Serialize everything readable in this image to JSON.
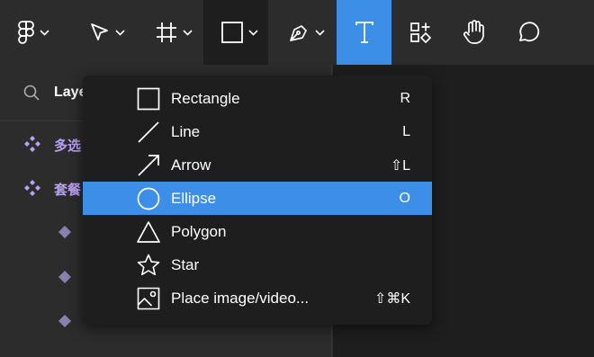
{
  "toolbar": {
    "tools": [
      {
        "name": "main-menu",
        "icon": "figma-logo-icon",
        "has_dropdown": true
      },
      {
        "name": "move",
        "icon": "move-cursor-icon",
        "has_dropdown": true
      },
      {
        "name": "frame",
        "icon": "frame-hash-icon",
        "has_dropdown": true
      },
      {
        "name": "shape",
        "icon": "rectangle-icon",
        "has_dropdown": true,
        "state": "open"
      },
      {
        "name": "pen",
        "icon": "pen-icon",
        "has_dropdown": true
      },
      {
        "name": "text",
        "icon": "text-icon",
        "has_dropdown": false,
        "state": "selected"
      },
      {
        "name": "resources",
        "icon": "resources-icon",
        "has_dropdown": false
      },
      {
        "name": "hand",
        "icon": "hand-icon",
        "has_dropdown": false
      },
      {
        "name": "comment",
        "icon": "comment-icon",
        "has_dropdown": false
      }
    ],
    "accent_color": "#3d8ee6"
  },
  "left_panel": {
    "search_label": "Laye",
    "layers": [
      {
        "name": "多选",
        "icon": "component-icon",
        "color": "#b9a1f5"
      },
      {
        "name": "套餐",
        "icon": "component-icon",
        "color": "#b9a1f5"
      },
      {
        "name": "",
        "icon": "instance-icon"
      },
      {
        "name": "",
        "icon": "instance-icon"
      },
      {
        "name": "",
        "icon": "instance-icon"
      }
    ]
  },
  "shape_menu": {
    "items": [
      {
        "label": "Rectangle",
        "shortcut": "R",
        "icon": "rectangle-icon",
        "highlighted": false
      },
      {
        "label": "Line",
        "shortcut": "L",
        "icon": "line-icon",
        "highlighted": false
      },
      {
        "label": "Arrow",
        "shortcut": "⇧L",
        "icon": "arrow-icon",
        "highlighted": false
      },
      {
        "label": "Ellipse",
        "shortcut": "O",
        "icon": "ellipse-icon",
        "highlighted": true
      },
      {
        "label": "Polygon",
        "shortcut": "",
        "icon": "polygon-icon",
        "highlighted": false
      },
      {
        "label": "Star",
        "shortcut": "",
        "icon": "star-icon",
        "highlighted": false
      },
      {
        "label": "Place image/video...",
        "shortcut": "⇧⌘K",
        "icon": "image-icon",
        "highlighted": false
      }
    ]
  }
}
